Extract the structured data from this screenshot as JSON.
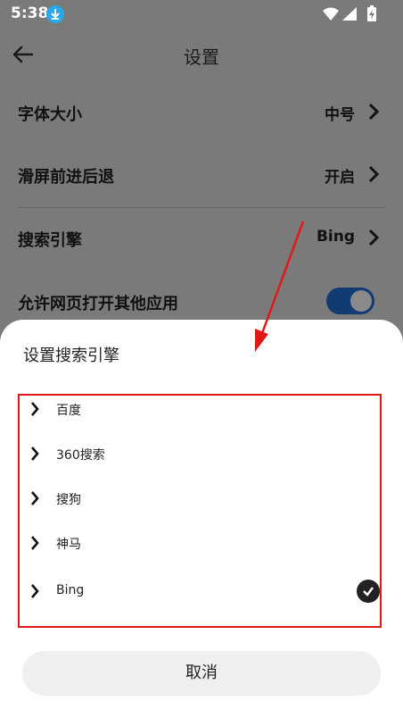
{
  "status_bar": {
    "time": "5:38",
    "icons": [
      "download-icon",
      "wifi-icon",
      "signal-icon",
      "battery-charging-icon"
    ]
  },
  "app_bar": {
    "title": "设置"
  },
  "settings": [
    {
      "label": "字体大小",
      "value": "中号"
    },
    {
      "label": "滑屏前进后退",
      "value": "开启"
    },
    {
      "label": "搜索引擎",
      "value": "Bing"
    },
    {
      "label": "允许网页打开其他应用",
      "toggle_on": true
    }
  ],
  "sheet": {
    "title": "设置搜索引擎",
    "engines": [
      {
        "name": "百度",
        "selected": false
      },
      {
        "name": "360搜索",
        "selected": false
      },
      {
        "name": "搜狗",
        "selected": false
      },
      {
        "name": "神马",
        "selected": false
      },
      {
        "name": "Bing",
        "selected": true
      }
    ],
    "cancel_label": "取消"
  },
  "colors": {
    "highlight_border": "#e01818",
    "toggle_track": "#103c73",
    "accent_download": "#29a8f0"
  }
}
